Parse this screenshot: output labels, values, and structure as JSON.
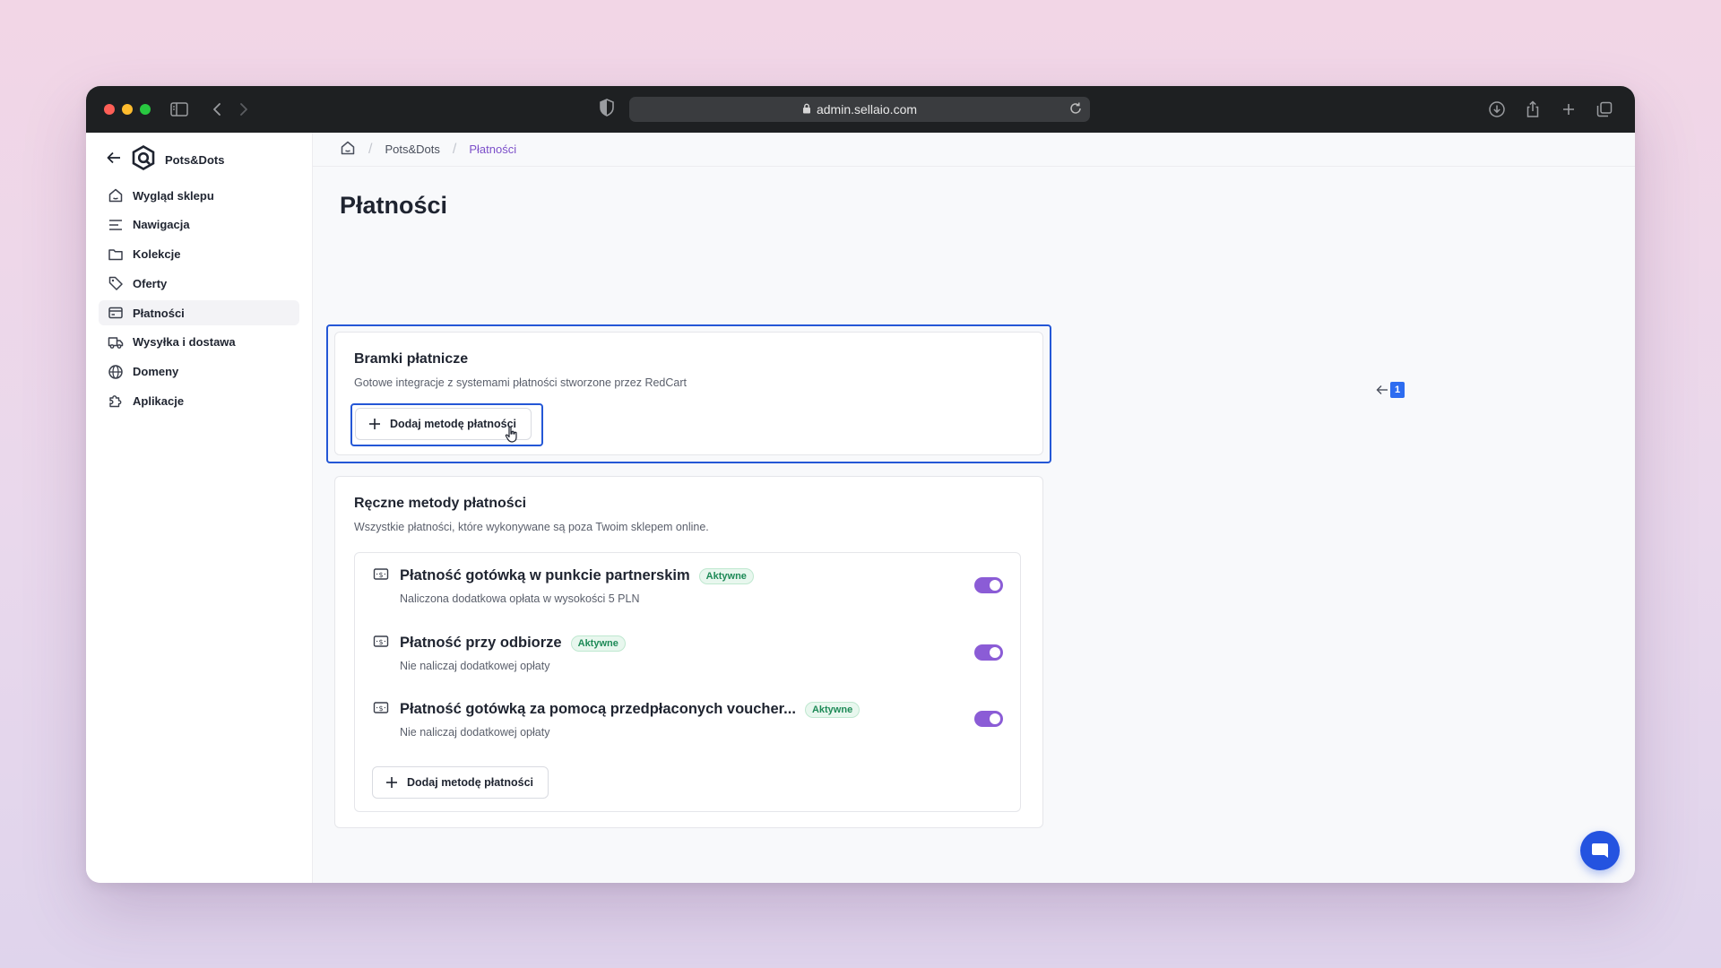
{
  "browser": {
    "url": "admin.sellaio.com"
  },
  "sidebar": {
    "brand": "Pots&Dots",
    "items": [
      {
        "label": "Wygląd sklepu",
        "icon": "home-icon"
      },
      {
        "label": "Nawigacja",
        "icon": "menu-lines-icon"
      },
      {
        "label": "Kolekcje",
        "icon": "folder-icon"
      },
      {
        "label": "Oferty",
        "icon": "tag-icon"
      },
      {
        "label": "Płatności",
        "icon": "credit-card-icon",
        "active": true
      },
      {
        "label": "Wysyłka i dostawa",
        "icon": "truck-icon"
      },
      {
        "label": "Domeny",
        "icon": "globe-icon"
      },
      {
        "label": "Aplikacje",
        "icon": "puzzle-icon"
      }
    ]
  },
  "breadcrumb": {
    "store": "Pots&Dots",
    "current": "Płatności"
  },
  "page": {
    "title": "Płatności"
  },
  "gateways": {
    "title": "Bramki płatnicze",
    "description": "Gotowe integracje z systemami płatności stworzone przez RedCart",
    "button": "Dodaj metodę płatności"
  },
  "manual": {
    "title": "Ręczne metody płatności",
    "description": "Wszystkie płatności, które wykonywane są poza Twoim sklepem online.",
    "methods": [
      {
        "name": "Płatność gotówką w punkcie partnerskim",
        "status": "Aktywne",
        "subtitle": "Naliczona dodatkowa opłata w wysokości 5 PLN",
        "enabled": true
      },
      {
        "name": "Płatność przy odbiorze",
        "status": "Aktywne",
        "subtitle": "Nie naliczaj dodatkowej opłaty",
        "enabled": true
      },
      {
        "name": "Płatność gotówką za pomocą przedpłaconych voucher...",
        "status": "Aktywne",
        "subtitle": "Nie naliczaj dodatkowej opłaty",
        "enabled": true
      }
    ],
    "button": "Dodaj metodę płatności"
  },
  "annotation": {
    "number": "1"
  },
  "colors": {
    "accent": "#8b5cd6",
    "highlight": "#2457d6",
    "active_badge": "#1e8a57",
    "chat": "#2453e0"
  }
}
